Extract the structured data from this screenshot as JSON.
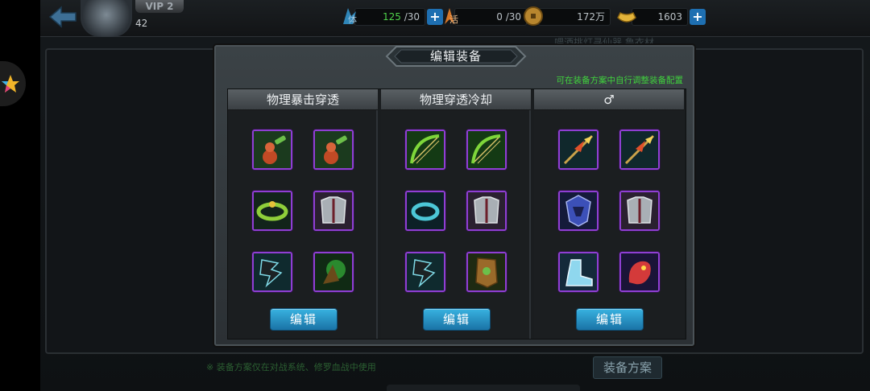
{
  "header": {
    "vip": "VIP 2",
    "level": "42",
    "stamina": {
      "label": "体",
      "value": "125",
      "max": "/30"
    },
    "vitality": {
      "label": "活",
      "value": "0",
      "max": "/30"
    },
    "gold": {
      "value": "172万"
    },
    "ingot": {
      "value": "1603"
    },
    "hint": "喂酒挑灯寻仙器 鲁衣材"
  },
  "background": {
    "bottom_hint": "※ 装备方案仅在对战系统、修罗血战中使用",
    "plan_button": "装备方案"
  },
  "modal": {
    "title": "编辑装备",
    "tip": "可在装备方案中自行调整装备配置",
    "columns": [
      {
        "name": "物理暴击穿透",
        "edit_label": "编辑",
        "items": [
          "gourd-flask-icon",
          "gourd-flask-icon",
          "jade-ring-icon",
          "silver-armor-icon",
          "claw-gauntlet-icon",
          "green-amulet-icon"
        ]
      },
      {
        "name": "物理穿透冷却",
        "edit_label": "编辑",
        "items": [
          "green-bow-icon",
          "green-bow-icon",
          "cyan-ring-icon",
          "silver-armor-icon",
          "claw-gauntlet-icon",
          "wooden-token-icon"
        ]
      },
      {
        "name": "♂",
        "edit_label": "编辑",
        "items": [
          "flame-spear-icon",
          "flame-spear-icon",
          "blue-helmet-icon",
          "silver-armor-icon",
          "crystal-boots-icon",
          "red-dragon-icon"
        ]
      }
    ]
  },
  "colors": {
    "accent_green": "#40d23d",
    "item_border": "#8f3fd3",
    "edit_button": "#1f8cc4"
  }
}
